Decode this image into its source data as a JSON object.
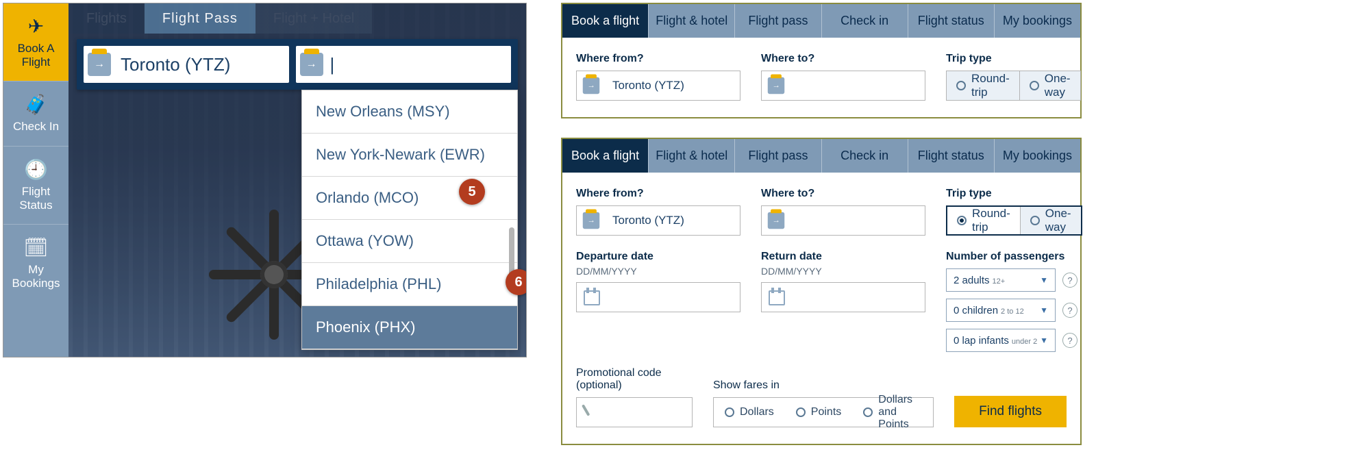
{
  "left": {
    "rail": {
      "book": "Book A Flight",
      "checkin": "Check In",
      "status": "Flight Status",
      "mybook": "My Bookings"
    },
    "tabs": {
      "flights": "Flights",
      "pass": "Flight  Pass",
      "hotel": "Flight + Hotel"
    },
    "from_value": "Toronto (YTZ)",
    "to_value": "",
    "dropdown": [
      "New Orleans (MSY)",
      "New York-Newark (EWR)",
      "Orlando (MCO)",
      "Ottawa (YOW)",
      "Philadelphia (PHL)",
      "Phoenix (PHX)"
    ],
    "dropdown_selected_index": 5,
    "callouts": {
      "five": "5",
      "six": "6"
    }
  },
  "right": {
    "tabs": {
      "book": "Book a flight",
      "hotel": "Flight & hotel",
      "pass": "Flight pass",
      "checkin": "Check in",
      "status": "Flight status",
      "mybook": "My bookings"
    },
    "labels": {
      "from": "Where from?",
      "to": "Where to?",
      "trip": "Trip type",
      "dep": "Departure date",
      "ret": "Return date",
      "datefmt": "DD/MM/YYYY",
      "pax": "Number of passengers",
      "promo": "Promotional code (optional)",
      "fares": "Show fares in"
    },
    "from_value": "Toronto (YTZ)",
    "trip": {
      "round": "Round-trip",
      "one": "One-way"
    },
    "pax": {
      "adults": "2 adults",
      "adults_sub": "12+",
      "children": "0 children",
      "children_sub": "2 to 12",
      "infants": "0 lap infants",
      "infants_sub": "under 2"
    },
    "fares": {
      "dollars": "Dollars",
      "points": "Points",
      "both": "Dollars and Points"
    },
    "find": "Find flights",
    "help": "?"
  }
}
